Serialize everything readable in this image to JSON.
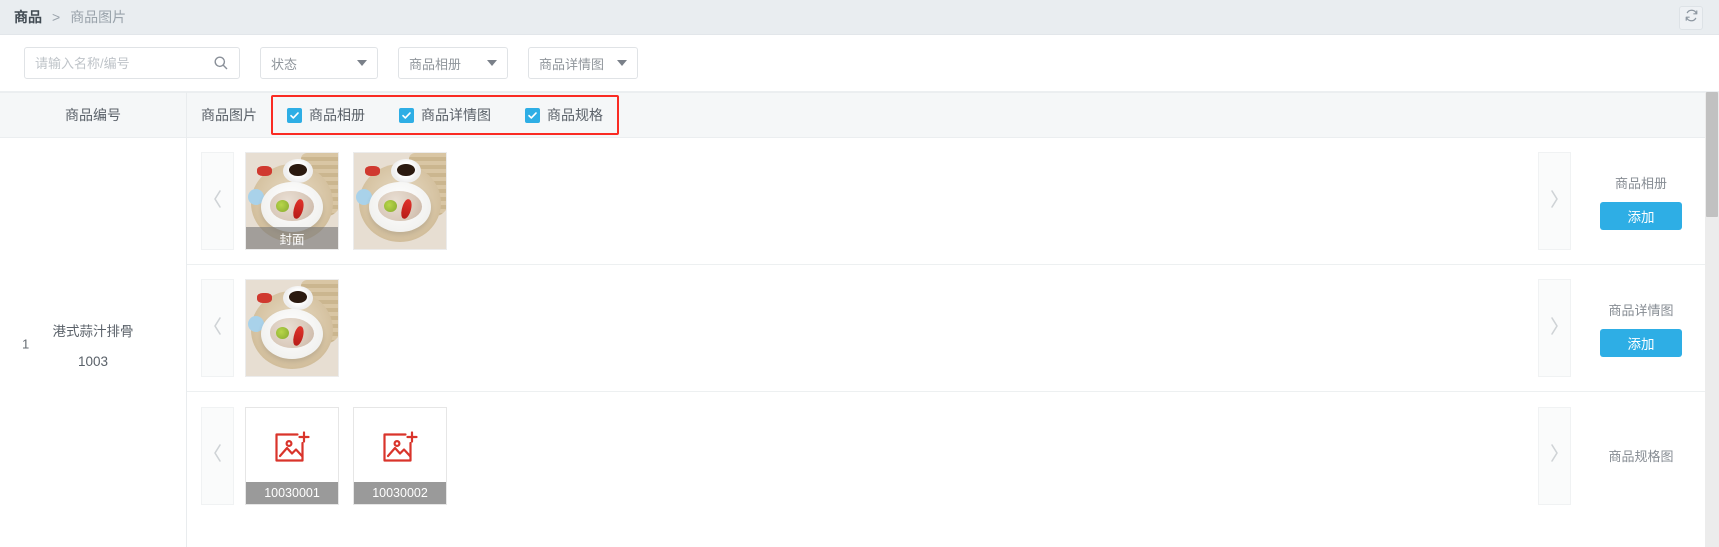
{
  "breadcrumb": {
    "root": "商品",
    "separator": ">",
    "current": "商品图片"
  },
  "toolbar": {
    "refresh_icon": "refresh-icon"
  },
  "filters": {
    "search": {
      "placeholder": "请输入名称/编号",
      "value": "",
      "icon": "search-icon"
    },
    "selects": [
      {
        "label": "状态",
        "icon": "chevron-down-icon"
      },
      {
        "label": "商品相册",
        "icon": "chevron-down-icon"
      },
      {
        "label": "商品详情图",
        "icon": "chevron-down-icon"
      }
    ]
  },
  "table": {
    "headers": {
      "code_column": "商品编号",
      "image_column": "商品图片"
    },
    "checkboxes": [
      {
        "label": "商品相册",
        "checked": true
      },
      {
        "label": "商品详情图",
        "checked": true
      },
      {
        "label": "商品规格",
        "checked": true
      }
    ],
    "highlight_color": "#fa2b23",
    "rows": [
      {
        "index": "1",
        "name": "港式蒜汁排骨",
        "code": "1003",
        "groups": [
          {
            "panel_label": "商品相册",
            "add_label": "添加",
            "prev_icon": "chevron-left-icon",
            "next_icon": "chevron-right-icon",
            "thumbs": [
              {
                "type": "photo",
                "caption": "封面"
              },
              {
                "type": "photo",
                "caption": ""
              }
            ]
          },
          {
            "panel_label": "商品详情图",
            "add_label": "添加",
            "prev_icon": "chevron-left-icon",
            "next_icon": "chevron-right-icon",
            "thumbs": [
              {
                "type": "photo",
                "caption": ""
              }
            ]
          },
          {
            "panel_label": "商品规格图",
            "add_label": "",
            "prev_icon": "chevron-left-icon",
            "next_icon": "chevron-right-icon",
            "thumbs": [
              {
                "type": "placeholder",
                "caption": "10030001"
              },
              {
                "type": "placeholder",
                "caption": "10030002"
              }
            ]
          }
        ]
      }
    ]
  },
  "colors": {
    "accent": "#2eaee5",
    "highlight": "#fa2b23",
    "header_bg": "#f5f7f8"
  }
}
